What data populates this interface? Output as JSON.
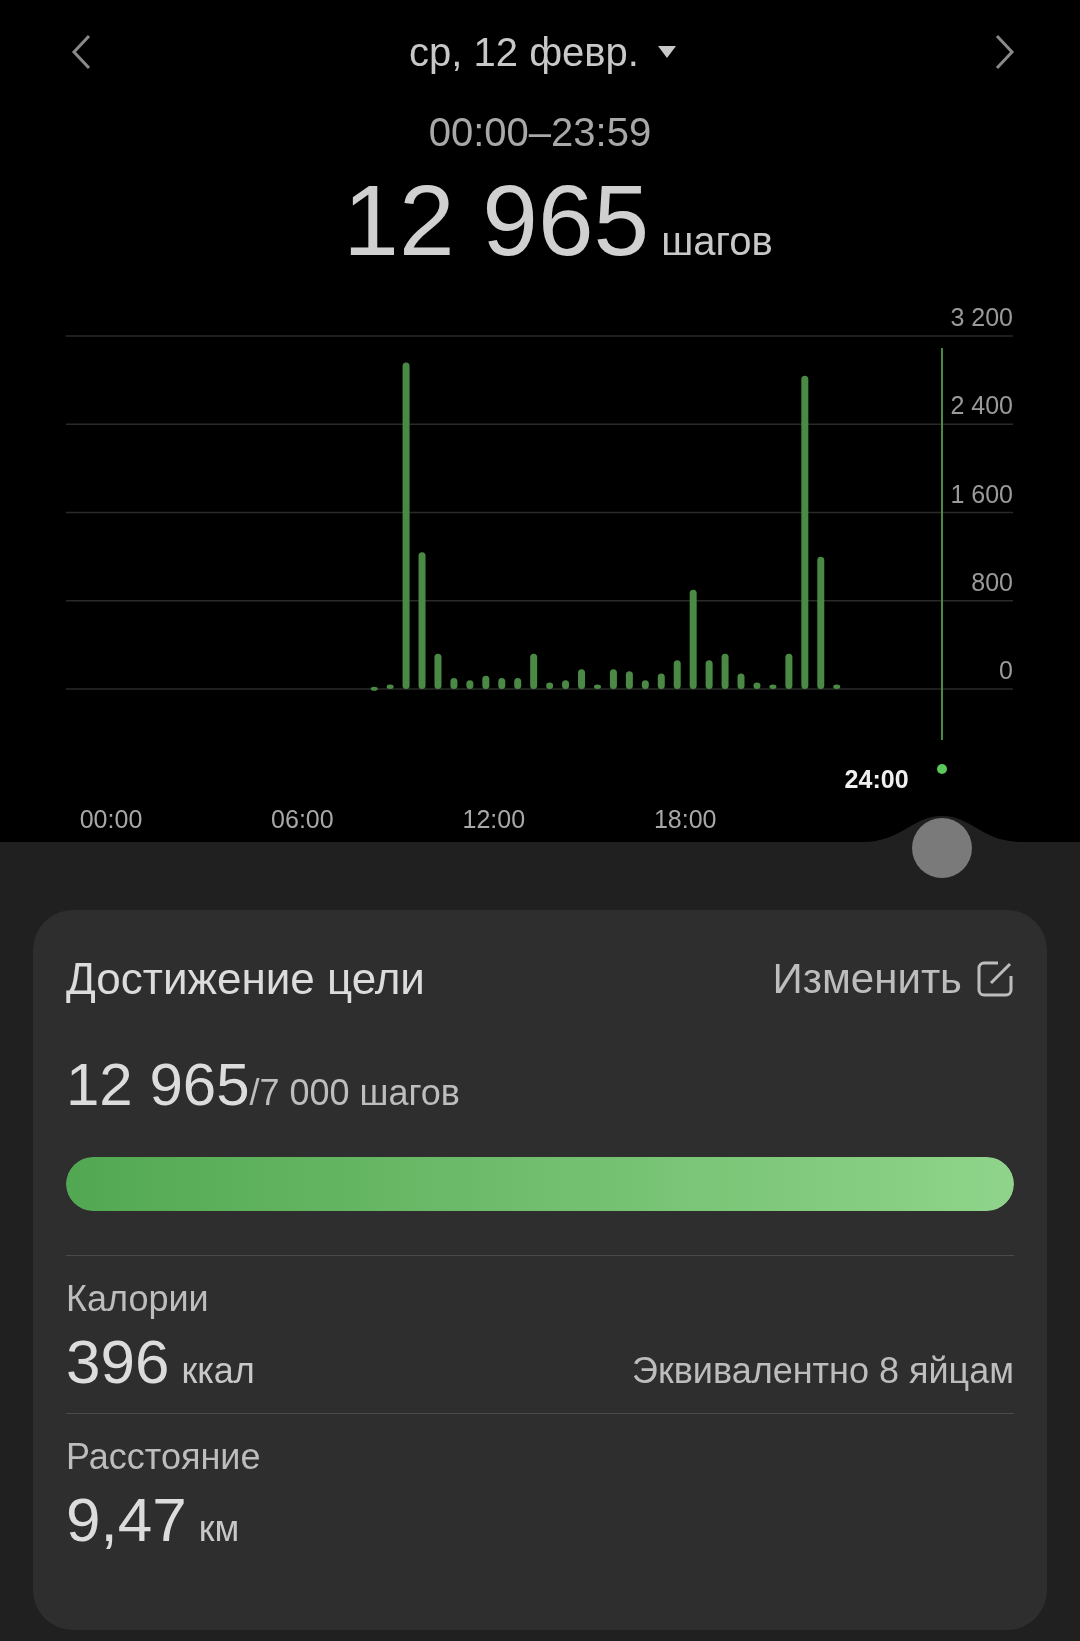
{
  "header": {
    "date": "ср, 12 февр.",
    "time_range": "00:00–23:59",
    "steps": "12 965",
    "steps_unit": "шагов"
  },
  "chart": {
    "selected_time": "24:00",
    "chart_data": {
      "type": "bar",
      "categories": [
        "00:00",
        null,
        null,
        null,
        null,
        null,
        null,
        null,
        null,
        null,
        null,
        null,
        "06:00",
        null,
        null,
        null,
        null,
        null,
        null,
        null,
        null,
        null,
        null,
        null,
        "12:00",
        null,
        null,
        null,
        null,
        null,
        null,
        null,
        null,
        null,
        null,
        null,
        "18:00",
        null,
        null,
        null,
        null,
        null,
        null,
        null,
        null,
        null,
        null,
        null
      ],
      "series": [
        {
          "color": "#4a8a45",
          "values": [
            null,
            null,
            null,
            null,
            null,
            null,
            null,
            null,
            null,
            null,
            null,
            null,
            null,
            null,
            null,
            null,
            20,
            40,
            2960,
            1240,
            320,
            100,
            80,
            120,
            100,
            100,
            320,
            60,
            80,
            180,
            40,
            180,
            160,
            80,
            140,
            260,
            900,
            260,
            320,
            140,
            60,
            40,
            320,
            2840,
            1200,
            40,
            null,
            null
          ]
        }
      ],
      "grid": true,
      "ylim": [
        0,
        3200
      ],
      "yticks": [
        {
          "value": 0,
          "label": "0"
        },
        {
          "value": 800,
          "label": "800"
        },
        {
          "value": 1600,
          "label": "1 600"
        },
        {
          "value": 2400,
          "label": "2 400"
        },
        {
          "value": 3200,
          "label": "3 200"
        }
      ]
    }
  },
  "goal": {
    "title": "Достижение цели",
    "edit_label": "Изменить",
    "current": "12 965",
    "target": "/7 000 шагов",
    "level": 1
  },
  "stats": [
    {
      "label": "Калории",
      "value": "396",
      "unit": "ккал",
      "note": "Эквивалентно 8 яйцам"
    },
    {
      "label": "Расстояние",
      "value": "9,47",
      "unit": "км"
    }
  ]
}
